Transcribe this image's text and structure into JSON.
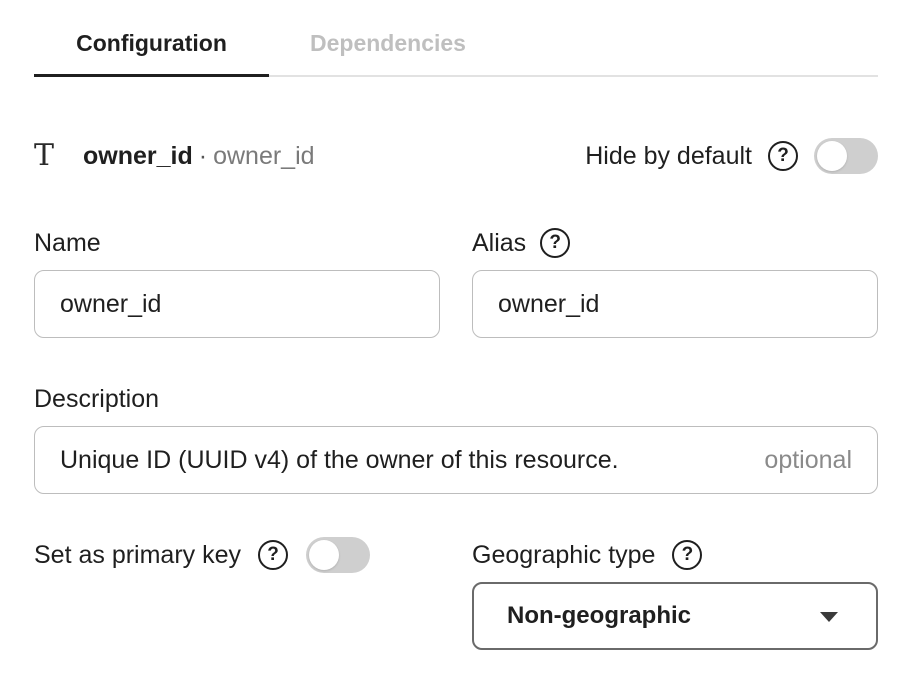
{
  "tabs": [
    {
      "label": "Configuration",
      "active": true
    },
    {
      "label": "Dependencies",
      "active": false
    }
  ],
  "field": {
    "type_icon": "text-type-icon",
    "type_glyph": "T",
    "name": "owner_id",
    "separator": "·",
    "source_name": "owner_id"
  },
  "hide_by_default": {
    "label": "Hide by default",
    "help": "?",
    "on": false
  },
  "name_field": {
    "label": "Name",
    "value": "owner_id"
  },
  "alias_field": {
    "label": "Alias",
    "help": "?",
    "value": "owner_id"
  },
  "description_field": {
    "label": "Description",
    "value": "Unique ID (UUID v4) of the owner of this resource.",
    "hint": "optional"
  },
  "primary_key": {
    "label": "Set as primary key",
    "help": "?",
    "on": false
  },
  "geographic_type": {
    "label": "Geographic type",
    "help": "?",
    "selected": "Non-geographic"
  },
  "colors": {
    "text": "#1f1f1f",
    "muted": "#bfbfbf",
    "toggle_off": "#cfcfcf",
    "border": "#bdbdbd"
  }
}
